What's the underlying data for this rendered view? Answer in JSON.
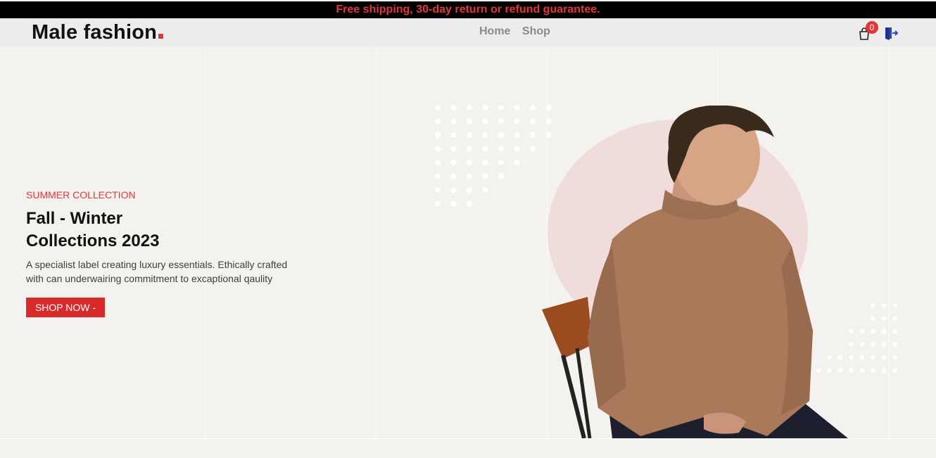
{
  "promo": {
    "text": "Free shipping, 30-day return or refund guarantee."
  },
  "header": {
    "logo": {
      "text": "Male fashion"
    },
    "nav": [
      {
        "label": "Home"
      },
      {
        "label": "Shop"
      }
    ],
    "cart": {
      "icon": "shopping-bag-icon",
      "count": "0"
    },
    "logout": {
      "icon": "logout-icon"
    }
  },
  "hero": {
    "subtitle": "SUMMER COLLECTION",
    "title_line1": "Fall - Winter",
    "title_line2": "Collections 2023",
    "description": "A specialist label creating luxury essentials. Ethically crafted with can underwairing commitment to excaptional qaulity",
    "button_label": "SHOP NOW -",
    "image": "male-model-sitting-on-chair"
  },
  "colors": {
    "accent": "#e53637",
    "button": "#d92a2b",
    "hero_bg": "#f3f2ee",
    "nav_bg": "#ececec",
    "circle": "#f1dcdc"
  }
}
